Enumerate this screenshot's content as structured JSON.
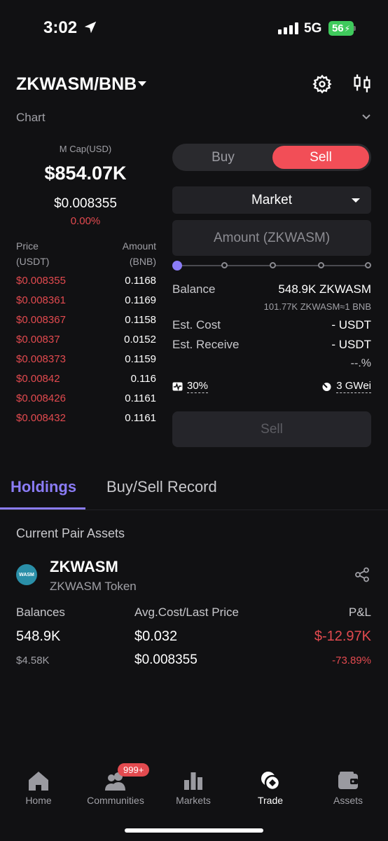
{
  "status": {
    "time": "3:02",
    "network": "5G",
    "battery": "56"
  },
  "header": {
    "pair": "ZKWASM/BNB",
    "chart_label": "Chart"
  },
  "token_stats": {
    "mcap_label": "M Cap(USD)",
    "mcap_value": "$854.07K",
    "price": "$0.008355",
    "change": "0.00%"
  },
  "orderbook": {
    "price_header": [
      "Price",
      "(USDT)"
    ],
    "amount_header": [
      "Amount",
      "(BNB)"
    ],
    "rows": [
      {
        "price": "$0.008355",
        "amount": "0.1168"
      },
      {
        "price": "$0.008361",
        "amount": "0.1169"
      },
      {
        "price": "$0.008367",
        "amount": "0.1158"
      },
      {
        "price": "$0.00837",
        "amount": "0.0152"
      },
      {
        "price": "$0.008373",
        "amount": "0.1159"
      },
      {
        "price": "$0.00842",
        "amount": "0.116"
      },
      {
        "price": "$0.008426",
        "amount": "0.1161"
      },
      {
        "price": "$0.008432",
        "amount": "0.1161"
      }
    ]
  },
  "trade": {
    "buy_label": "Buy",
    "sell_label": "Sell",
    "order_type": "Market",
    "amount_placeholder": "Amount (ZKWASM)",
    "slider_value": 0,
    "balance_label": "Balance",
    "balance_value": "548.9K ZKWASM",
    "balance_sub": "101.77K ZKWASM≈1 BNB",
    "est_cost_label": "Est. Cost",
    "est_cost_value": "- USDT",
    "est_receive_label": "Est. Receive",
    "est_receive_value": "- USDT",
    "pct_value": "--.%",
    "slippage": "30%",
    "gas": "3 GWei",
    "submit_label": "Sell"
  },
  "tabs": {
    "holdings": "Holdings",
    "record": "Buy/Sell Record"
  },
  "holdings": {
    "section_title": "Current Pair Assets",
    "symbol": "ZKWASM",
    "name": "ZKWASM Token",
    "logo_text": "WASM",
    "col_balances": "Balances",
    "col_avg": "Avg.Cost/Last Price",
    "col_pnl": "P&L",
    "balance": "548.9K",
    "balance_usd": "$4.58K",
    "avg_cost": "$0.032",
    "last_price": "$0.008355",
    "pnl": "$-12.97K",
    "pnl_pct": "-73.89%"
  },
  "nav": {
    "home": "Home",
    "communities": "Communities",
    "communities_badge": "999+",
    "markets": "Markets",
    "trade": "Trade",
    "assets": "Assets"
  },
  "colors": {
    "accent": "#8b7cf6",
    "sell": "#f24e57",
    "negative": "#e24a4f"
  }
}
